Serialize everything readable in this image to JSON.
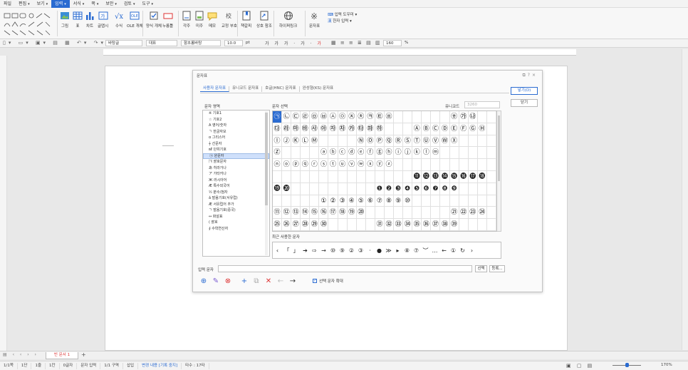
{
  "menubar": {
    "items": [
      {
        "label": "파일"
      },
      {
        "label": "편집",
        "dd": "▾"
      },
      {
        "label": "보기",
        "dd": "▾"
      },
      {
        "label": "입력",
        "dd": "▾"
      },
      {
        "label": "서식",
        "dd": "▾"
      },
      {
        "label": "쪽",
        "dd": "▾"
      },
      {
        "label": "보안",
        "dd": "▾"
      },
      {
        "label": "검토",
        "dd": "▾"
      },
      {
        "label": "도구",
        "dd": "▾"
      }
    ]
  },
  "ribbon": {
    "buttons": [
      "그림",
      "표",
      "차트",
      "글맵시",
      "수식",
      "OLE 개체",
      "양식 개체",
      "누름틀",
      "각주",
      "미주",
      "메모",
      "교정 부호",
      "책갈피",
      "상호 참조",
      "하이퍼링크",
      "문자표"
    ],
    "right_items": [
      "입력 도우미",
      "한자 입력"
    ]
  },
  "toolbar2": {
    "style": "바탕글",
    "category": "대표",
    "font": "함초롬바탕",
    "size": "10.0",
    "unit": "pt",
    "zoom": "160",
    "zoom_unit": "%"
  },
  "dialog": {
    "title": "문자표",
    "tabs": [
      {
        "label": "사용자 문자표"
      },
      {
        "label": "유니코드 문자표"
      },
      {
        "label": "호글(HNC) 문자표"
      },
      {
        "label": "완성형(KS) 문자표"
      }
    ],
    "insert_button": "넣기(D)",
    "close_button": "닫기",
    "area_label": "문자 영역",
    "char_label": "문자 선택",
    "unicode_label": "유니코드",
    "unicode_value": "3260",
    "areas": [
      {
        "label": "※ 기호1"
      },
      {
        "label": "☆ 기호2"
      },
      {
        "label": "A 영어/숫자"
      },
      {
        "label": "ㄱ 한글자모"
      },
      {
        "label": "α 그리스어"
      },
      {
        "label": "┼ 선문자"
      },
      {
        "label": "㎖ 단위기호"
      },
      {
        "label": "㉠ 원문자"
      },
      {
        "label": "㈀ 괄호문자"
      },
      {
        "label": "あ 히라가나"
      },
      {
        "label": "ア 가타카나"
      },
      {
        "label": "Ж 러시아어"
      },
      {
        "label": "Æ 특수외국어"
      },
      {
        "label": "½ 분수/첨자"
      },
      {
        "label": "ǎ 발음기호(서유럽)"
      },
      {
        "label": "Æ 서유럽어 추가"
      },
      {
        "label": "ㄱ 발음기호(중국)"
      },
      {
        "label": "↔ 화살표"
      },
      {
        "label": "( 괄호"
      },
      {
        "label": "∮ 수학연산자"
      }
    ],
    "grid": [
      [
        "㉠",
        "㉡",
        "㉢",
        "㉣",
        "㉤",
        "㉥",
        "㉦",
        "㉧",
        "㉨",
        "㉩",
        "㉪",
        "㉫",
        "㉬",
        "",
        "",
        "",
        "",
        "",
        "",
        "㉭",
        "㉮",
        "㉯",
        "",
        ""
      ],
      [
        "㉰",
        "㉱",
        "㉲",
        "㉳",
        "㉴",
        "㉵",
        "㉶",
        "㉷",
        "㉸",
        "㉹",
        "㉺",
        "㉻",
        "",
        "",
        "",
        "Ⓐ",
        "Ⓑ",
        "Ⓒ",
        "Ⓓ",
        "Ⓔ",
        "Ⓕ",
        "Ⓖ",
        "Ⓗ",
        ""
      ],
      [
        "Ⓘ",
        "Ⓙ",
        "Ⓚ",
        "Ⓛ",
        "Ⓜ",
        "",
        "",
        "",
        "",
        "Ⓝ",
        "Ⓞ",
        "Ⓟ",
        "Ⓠ",
        "Ⓡ",
        "Ⓢ",
        "Ⓣ",
        "Ⓤ",
        "Ⓥ",
        "Ⓦ",
        "Ⓧ",
        "",
        "",
        "",
        ""
      ],
      [
        "Ⓩ",
        "",
        "",
        "",
        "",
        "ⓐ",
        "ⓑ",
        "ⓒ",
        "ⓓ",
        "ⓔ",
        "ⓕ",
        "ⓖ",
        "ⓗ",
        "ⓘ",
        "ⓙ",
        "ⓚ",
        "ⓛ",
        "ⓜ",
        "",
        "",
        "",
        "",
        "",
        ""
      ],
      [
        "ⓝ",
        "ⓞ",
        "ⓟ",
        "ⓠ",
        "ⓡ",
        "ⓢ",
        "ⓣ",
        "ⓤ",
        "ⓥ",
        "ⓦ",
        "ⓧ",
        "ⓨ",
        "ⓩ",
        "",
        "",
        "",
        "",
        "",
        "",
        "",
        "",
        "",
        "",
        ""
      ],
      [
        "",
        "",
        "",
        "",
        "",
        "",
        "",
        "",
        "",
        "",
        "",
        "",
        "",
        "",
        "",
        "⓫",
        "⓬",
        "⓭",
        "⓮",
        "⓯",
        "⓰",
        "⓱",
        "⓲",
        ""
      ],
      [
        "⓳",
        "⓴",
        "",
        "",
        "",
        "",
        "",
        "",
        "",
        "",
        "",
        "❶",
        "❷",
        "❸",
        "❹",
        "❺",
        "❻",
        "❼",
        "❽",
        "❾",
        "",
        "",
        "",
        ""
      ],
      [
        "",
        "",
        "",
        "",
        "",
        "①",
        "②",
        "③",
        "④",
        "⑤",
        "⑥",
        "⑦",
        "⑧",
        "⑨",
        "⑩",
        "",
        "",
        "",
        "",
        "",
        "",
        "",
        "",
        ""
      ],
      [
        "⑪",
        "⑫",
        "⑬",
        "⑭",
        "⑮",
        "⑯",
        "⑰",
        "⑱",
        "⑲",
        "⑳",
        "",
        "",
        "",
        "",
        "",
        "",
        "",
        "",
        "",
        "㉑",
        "㉒",
        "㉓",
        "㉔",
        ""
      ],
      [
        "㉕",
        "㉖",
        "㉗",
        "㉘",
        "㉙",
        "㉚",
        "",
        "",
        "",
        "",
        "",
        "㉛",
        "㉜",
        "㉝",
        "㉞",
        "㉟",
        "㊱",
        "㊲",
        "㊳",
        "㊴",
        "",
        "",
        "",
        ""
      ]
    ],
    "recent_label": "최근 사용한 문자",
    "recent": [
      "‹",
      "「",
      "」",
      "➔",
      "⇨",
      "→",
      "⑩",
      "⑨",
      "②",
      "③",
      "·",
      "●",
      "≫",
      "▸",
      "⑧",
      "⑦",
      "︶",
      "…",
      "←",
      "①",
      "↻",
      "›"
    ],
    "input_label": "입력 문자",
    "select_button": "선택",
    "register_button": "등록...",
    "enlarge_label": "선택 문자 확대"
  },
  "sheet": {
    "tab_label": "빈 문서 1"
  },
  "statusbar": {
    "items": [
      {
        "label": "1/1쪽"
      },
      {
        "label": "1단"
      },
      {
        "label": "1줄"
      },
      {
        "label": "1칸"
      },
      {
        "label": "0글자"
      },
      {
        "label": "문자 입력"
      },
      {
        "label": "1/1 구역"
      },
      {
        "label": "삽입"
      },
      {
        "label": "변경 내용 [기록 중지]"
      },
      {
        "label": "타수 : 17타"
      }
    ],
    "zoom": "170%"
  },
  "colors": {
    "accent": "#2a6bd1",
    "selected_bg": "#cfe0fb"
  }
}
